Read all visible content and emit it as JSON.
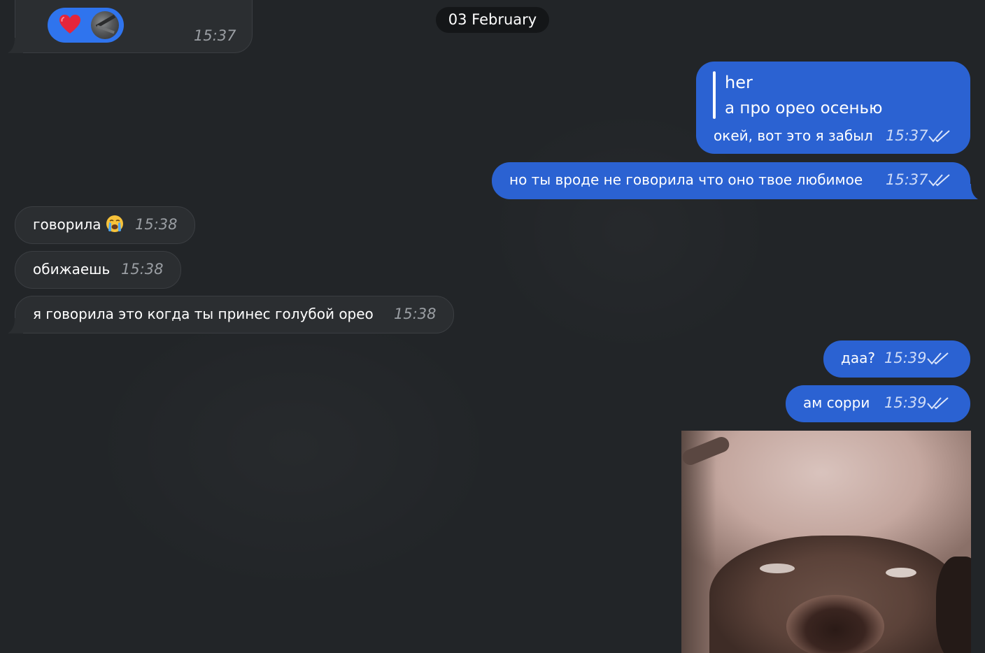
{
  "date_separator": "03 February",
  "messages": [
    {
      "side": "in",
      "time": "15:37",
      "reaction": "heart-emoji"
    },
    {
      "side": "out",
      "quote_author": "her",
      "quote_text": "а про орео осенью",
      "text": "окей, вот это я забыл",
      "time": "15:37",
      "status": "read"
    },
    {
      "side": "out",
      "text": "но ты вроде не говорила что оно твое любимое",
      "time": "15:37",
      "status": "read"
    },
    {
      "side": "in",
      "text": "говорила",
      "emoji": "loudly-crying-face",
      "time": "15:38"
    },
    {
      "side": "in",
      "text": "обижаешь",
      "time": "15:38"
    },
    {
      "side": "in",
      "text": "я говорила это когда ты принес голубой орео",
      "time": "15:38"
    },
    {
      "side": "out",
      "text": "даа?",
      "time": "15:39",
      "status": "read"
    },
    {
      "side": "out",
      "text": "ам сорри",
      "time": "15:39",
      "status": "read"
    },
    {
      "side": "out",
      "type": "photo",
      "content": "crying-cat-photo"
    }
  ],
  "colors": {
    "background": "#222528",
    "incoming_bubble": "#2b2e31",
    "outgoing_bubble": "#2b62d2",
    "reaction_pill": "#2f74ee",
    "date_pill": "#141618"
  }
}
